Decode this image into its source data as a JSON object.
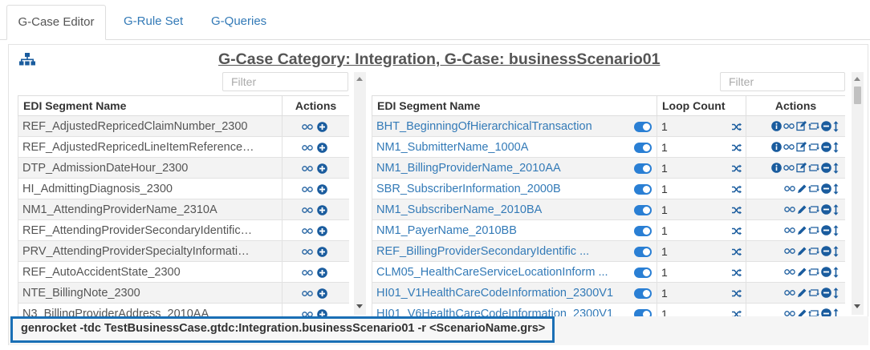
{
  "tabs": [
    {
      "label": "G-Case Editor",
      "active": true
    },
    {
      "label": "G-Rule Set",
      "active": false
    },
    {
      "label": "G-Queries",
      "active": false
    }
  ],
  "title": "G-Case Category: Integration, G-Case: businessScenario01",
  "left": {
    "filter_placeholder": "Filter",
    "headers": {
      "name": "EDI Segment Name",
      "actions": "Actions"
    },
    "rows": [
      "REF_AdjustedRepricedClaimNumber_2300",
      "REF_AdjustedRepricedLineItemReference…",
      "DTP_AdmissionDateHour_2300",
      "HI_AdmittingDiagnosis_2300",
      "NM1_AttendingProviderName_2310A",
      "REF_AttendingProviderSecondaryIdentific…",
      "PRV_AttendingProviderSpecialtyInformati…",
      "REF_AutoAccidentState_2300",
      "NTE_BillingNote_2300",
      "N3_BillingProviderAddress_2010AA"
    ]
  },
  "right": {
    "filter_placeholder": "Filter",
    "headers": {
      "name": "EDI Segment Name",
      "loop": "Loop Count",
      "actions": "Actions"
    },
    "rows": [
      {
        "name": "BHT_BeginningOfHierarchicalTransaction",
        "count": "1",
        "info": true
      },
      {
        "name": "NM1_SubmitterName_1000A",
        "count": "1",
        "info": true
      },
      {
        "name": "NM1_BillingProviderName_2010AA",
        "count": "1",
        "info": true
      },
      {
        "name": "SBR_SubscriberInformation_2000B",
        "count": "1",
        "info": false
      },
      {
        "name": "NM1_SubscriberName_2010BA",
        "count": "1",
        "info": false
      },
      {
        "name": "NM1_PayerName_2010BB",
        "count": "1",
        "info": false
      },
      {
        "name": "REF_BillingProviderSecondaryIdentific ...",
        "count": "1",
        "info": false
      },
      {
        "name": "CLM05_HealthCareServiceLocationInform ...",
        "count": "1",
        "info": false
      },
      {
        "name": "HI01_V1HealthCareCodeInformation_2300V1",
        "count": "1",
        "info": false
      },
      {
        "name": "HI01_V6HealthCareCodeInformation_2300V1",
        "count": "1",
        "info": false
      }
    ]
  },
  "command": "genrocket -tdc TestBusinessCase.gtdc:Integration.businessScenario01 -r <ScenarioName.grs>",
  "colors": {
    "link": "#337ab7",
    "icon": "#1a5c9e",
    "highlight_border": "#1a6fb5"
  }
}
